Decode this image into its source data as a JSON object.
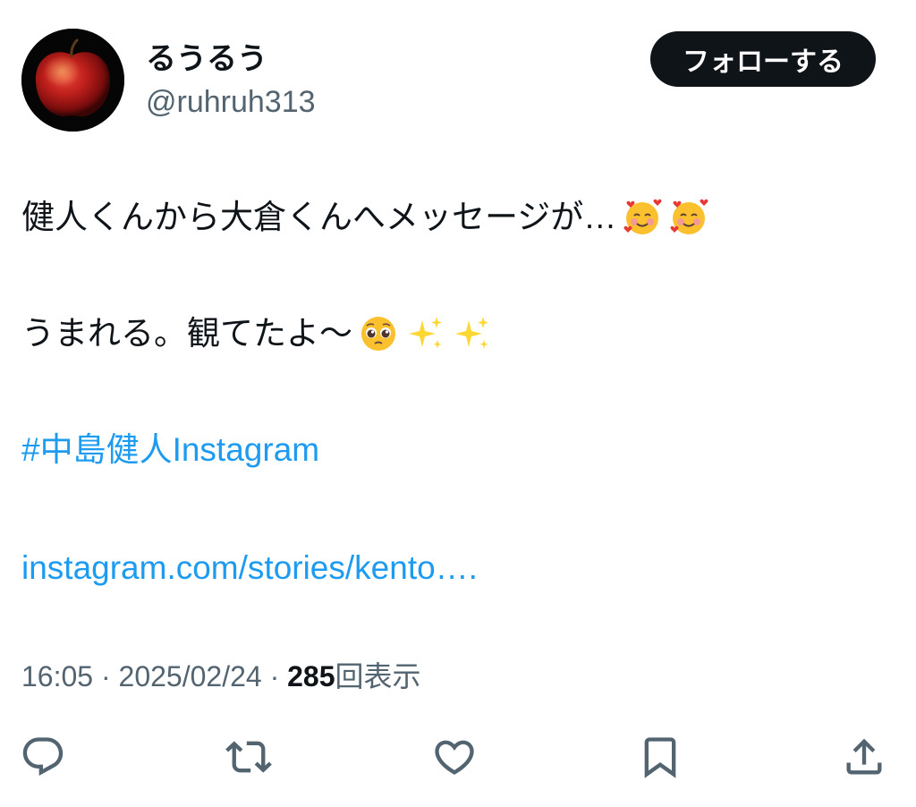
{
  "user": {
    "display_name": "るうるう",
    "handle": "@ruhruh313",
    "avatar_icon": "apple-avatar"
  },
  "follow_button": {
    "label": "フォローする"
  },
  "tweet": {
    "line1_text": "健人くんから大倉くんへメッセージが…",
    "line1_emojis": [
      "smiling-face-with-hearts-icon",
      "smiling-face-with-hearts-icon"
    ],
    "line2_text": "うまれる。観てたよ〜",
    "line2_emojis": [
      "pleading-face-icon",
      "sparkles-icon",
      "sparkles-icon"
    ],
    "hashtag": "#中島健人Instagram",
    "link": "instagram.com/stories/kento…."
  },
  "meta": {
    "time": "16:05",
    "separator": "·",
    "date": "2025/02/24",
    "views_count": "285",
    "views_label": "回表示"
  },
  "actions": {
    "reply": "reply-icon",
    "retweet": "retweet-icon",
    "like": "heart-icon",
    "bookmark": "bookmark-icon",
    "share": "share-icon"
  },
  "colors": {
    "text": "#0f1419",
    "secondary": "#536471",
    "link": "#1d9bf0",
    "button_bg": "#0f1419"
  }
}
